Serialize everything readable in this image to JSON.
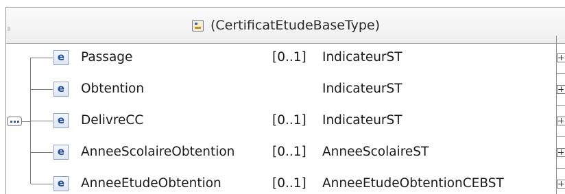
{
  "type_header": {
    "label": "(CertificatEtudeBaseType)",
    "icon": "complex-type-icon"
  },
  "compositor": {
    "kind": "sequence",
    "icon": "sequence-icon"
  },
  "elements": [
    {
      "icon_glyph": "e",
      "name": "Passage",
      "cardinality": "[0..1]",
      "type": "IndicateurST"
    },
    {
      "icon_glyph": "e",
      "name": "Obtention",
      "cardinality": "",
      "type": "IndicateurST"
    },
    {
      "icon_glyph": "e",
      "name": "DelivreCC",
      "cardinality": "[0..1]",
      "type": "IndicateurST"
    },
    {
      "icon_glyph": "e",
      "name": "AnneeScolaireObtention",
      "cardinality": "[0..1]",
      "type": "AnneeScolaireST"
    },
    {
      "icon_glyph": "e",
      "name": "AnneeEtudeObtention",
      "cardinality": "[0..1]",
      "type": "AnneeEtudeObtentionCEBST"
    }
  ]
}
